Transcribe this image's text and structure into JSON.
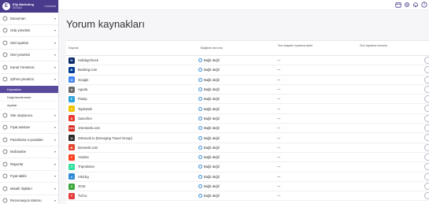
{
  "brand": {
    "logo_letter": "E",
    "name": "Elly Marketing",
    "id": "500452",
    "country": "Colombia"
  },
  "sidebar": {
    "items": [
      {
        "label": "Danışman",
        "icon": "user-icon"
      },
      {
        "label": "Oda yönetimi",
        "icon": "bed-icon"
      },
      {
        "label": "Otel ayarları",
        "icon": "hotel-icon"
      },
      {
        "label": "Otel yönetimi",
        "icon": "building-icon"
      },
      {
        "label": "Kanal Yöneticisi",
        "icon": "channel-icon"
      },
      {
        "label": "Şöhret yönetimi",
        "icon": "star-icon"
      }
    ],
    "sub_items": [
      {
        "label": "Kaynaklar",
        "active": true
      },
      {
        "label": "Değerlendirmeler",
        "active": false
      },
      {
        "label": "Ayarlar",
        "active": false
      }
    ],
    "items_bottom": [
      {
        "label": "Site oluşturucu",
        "icon": "globe-icon"
      },
      {
        "label": "Fiyat asistanı",
        "icon": "price-icon"
      },
      {
        "label": "Pazarlama e-postaları",
        "icon": "mail-icon"
      },
      {
        "label": "Muhasebe",
        "icon": "calculator-icon"
      },
      {
        "label": "Raporlar",
        "icon": "chart-icon"
      },
      {
        "label": "Fiyat takibi",
        "icon": "tag-icon"
      },
      {
        "label": "Misafir ilişkileri",
        "icon": "people-icon"
      },
      {
        "label": "Rezervasyon Motoru",
        "icon": "calendar-icon"
      }
    ]
  },
  "main": {
    "title": "Yorum kaynakları",
    "columns": {
      "name": "Kaynak",
      "status": "Bağlantı durumu",
      "date": "Son başarılı toplama tarihi",
      "total": "Son toplama durumu"
    },
    "rows": [
      {
        "name": "HolidayCheck",
        "status": "Bağlı değil",
        "date": "—",
        "logo_color": "#0a2a6b",
        "logo_text": "H"
      },
      {
        "name": "Booking.com",
        "status": "Bağlı değil",
        "date": "—",
        "logo_color": "#003b95",
        "logo_text": "B"
      },
      {
        "name": "Google",
        "status": "Bağlı değil",
        "date": "—",
        "logo_color": "#4285f4",
        "logo_text": "G"
      },
      {
        "name": "Agoda",
        "status": "Bağlı değil",
        "date": "—",
        "logo_color": "#6b6b6b",
        "logo_text": "a"
      },
      {
        "name": "Flamp",
        "status": "Bağlı değil",
        "date": "—",
        "logo_color": "#29a3dc",
        "logo_text": "F"
      },
      {
        "name": "Tophotels",
        "status": "Bağlı değil",
        "date": "—",
        "logo_color": "#f2c200",
        "logo_text": "T"
      },
      {
        "name": "Sutochno",
        "status": "Bağlı değil",
        "date": "—",
        "logo_color": "#e8392e",
        "logo_text": "S"
      },
      {
        "name": "101Hotels.com",
        "status": "Bağlı değil",
        "date": "—",
        "logo_color": "#d7261e",
        "logo_text": "101"
      },
      {
        "name": "Ostrovok.ru (Emerging Travel Group)",
        "status": "Bağlı değil",
        "date": "—",
        "logo_color": "#2a2a2a",
        "logo_text": "O"
      },
      {
        "name": "Bronevik.com",
        "status": "Bağlı değil",
        "date": "—",
        "logo_color": "#e2422b",
        "logo_text": "B"
      },
      {
        "name": "Yandex",
        "status": "Bağlı değil",
        "date": "—",
        "logo_color": "#fc3f1d",
        "logo_text": "Y"
      },
      {
        "name": "TripAdvisor",
        "status": "Bağlı değil",
        "date": "—",
        "logo_color": "#34e0a1",
        "logo_text": "T"
      },
      {
        "name": "Visit.bg",
        "status": "Bağlı değil",
        "date": "—",
        "logo_color": "#2f8ad8",
        "logo_text": "v"
      },
      {
        "name": "2GIS",
        "status": "Bağlı değil",
        "date": "—",
        "logo_color": "#3aa63a",
        "logo_text": "2"
      },
      {
        "name": "Tvil.ru",
        "status": "Bağlı değil",
        "date": "—",
        "logo_color": "#e23c3c",
        "logo_text": "T"
      }
    ]
  },
  "topbar": {
    "icons": [
      "calendar-icon",
      "settings-icon",
      "bell-icon",
      "help-icon"
    ]
  }
}
